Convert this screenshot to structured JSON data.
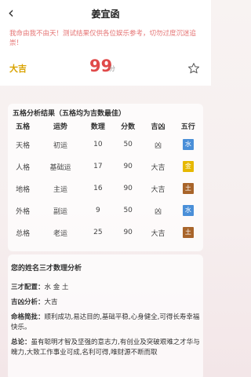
{
  "header": {
    "title": "姜宜函",
    "back_icon": "chevron-left-icon"
  },
  "disclaimer": "我命由我不由天！测试结果仅供各位娱乐参考，切勿过度沉迷追崇！",
  "score": {
    "level": "大吉",
    "value": "99",
    "unit": "分",
    "favorite_icon": "star-outline-icon"
  },
  "grid_card": {
    "heading": "五格分析结果（五格均为吉数最佳）",
    "columns": [
      "五格",
      "运势",
      "数理",
      "分数",
      "吉凶",
      "五行"
    ],
    "rows": [
      {
        "name": "天格",
        "luck": "初运",
        "number": "10",
        "score": "50",
        "verdict": "凶",
        "element": "水",
        "element_color": "#4a8fd8"
      },
      {
        "name": "人格",
        "luck": "基础运",
        "number": "17",
        "score": "90",
        "verdict": "大吉",
        "element": "金",
        "element_color": "#e6b800"
      },
      {
        "name": "地格",
        "luck": "主运",
        "number": "16",
        "score": "90",
        "verdict": "大吉",
        "element": "土",
        "element_color": "#a8642a"
      },
      {
        "name": "外格",
        "luck": "副运",
        "number": "9",
        "score": "50",
        "verdict": "凶",
        "element": "水",
        "element_color": "#4a8fd8"
      },
      {
        "name": "总格",
        "luck": "老运",
        "number": "25",
        "score": "90",
        "verdict": "大吉",
        "element": "土",
        "element_color": "#a8642a"
      }
    ]
  },
  "analysis": {
    "heading": "您的姓名三才数理分析",
    "sancai_label": "三才配置：",
    "sancai_value": "水 金 土",
    "jixiong_label": "吉凶分析：",
    "jixiong_value": "大吉",
    "mingge_label": "命格简批：",
    "mingge_value": "顺利成功,易达目的,基础平稳,心身健全,可得长寿幸福快乐。",
    "zonglun_label": "总论：",
    "zonglun_value": "虽有聪明才智及坚强的意志力,有创业及突破艰难之才华与魄力,大致工作事业可成,名利可得,唯财源不断而取"
  },
  "colors": {
    "accent_red": "#e04a4a",
    "lucky_gold": "#e3a400",
    "disclaimer_red": "#e57373"
  }
}
